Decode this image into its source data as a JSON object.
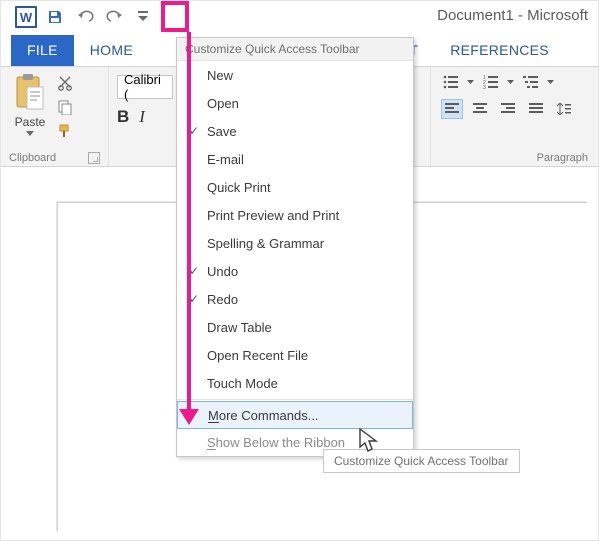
{
  "title_bar": {
    "document_title": "Document1 - Microsoft"
  },
  "qat": {
    "word_badge": "W"
  },
  "tabs": {
    "file": "FILE",
    "home": "HOME",
    "layout_partial": "UT",
    "references": "REFERENCES"
  },
  "ribbon": {
    "clipboard": {
      "paste": "Paste",
      "group_label": "Clipboard"
    },
    "font": {
      "family": "Calibri (",
      "bold": "B",
      "italic": "I"
    },
    "paragraph": {
      "group_label": "Paragraph"
    }
  },
  "menu": {
    "title": "Customize Quick Access Toolbar",
    "items": [
      {
        "label": "New",
        "checked": false
      },
      {
        "label": "Open",
        "checked": false
      },
      {
        "label": "Save",
        "checked": true
      },
      {
        "label": "E-mail",
        "checked": false
      },
      {
        "label": "Quick Print",
        "checked": false
      },
      {
        "label": "Print Preview and Print",
        "checked": false
      },
      {
        "label": "Spelling & Grammar",
        "checked": false
      },
      {
        "label": "Undo",
        "checked": true
      },
      {
        "label": "Redo",
        "checked": true
      },
      {
        "label": "Draw Table",
        "checked": false
      },
      {
        "label": "Open Recent File",
        "checked": false
      },
      {
        "label": "Touch Mode",
        "checked": false
      }
    ],
    "more_prefix": "M",
    "more_rest": "ore Commands...",
    "below_prefix": "S",
    "below_rest": "how Below the Ribbon"
  },
  "tooltip": "Customize Quick Access Toolbar"
}
